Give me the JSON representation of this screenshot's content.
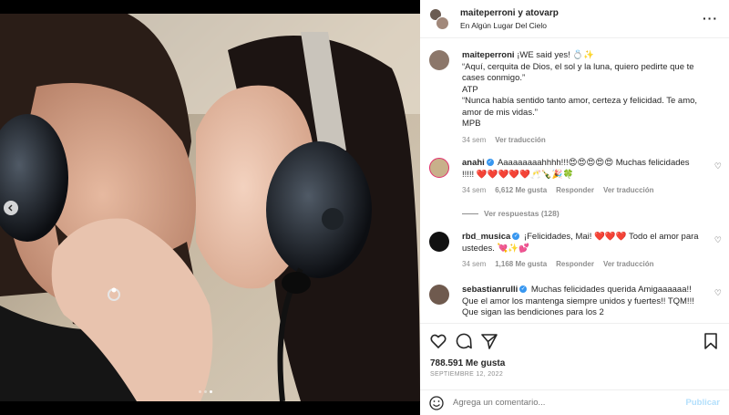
{
  "post": {
    "media": {
      "carousel_dots": 3,
      "active_dot": 2,
      "prev_icon": "chevron-left-icon"
    },
    "header": {
      "users": "maiteperroni y atovarp",
      "location": "En Algún Lugar Del Cielo",
      "more_icon": "more-horizontal-icon"
    },
    "caption": {
      "user": "maiteperroni",
      "lines": [
        "¡WE said yes! 💍✨",
        "“Aquí, cerquita de Dios, el sol y la luna, quiero pedirte que te cases conmigo.”",
        "ATP",
        "“Nunca había sentido tanto amor, certeza y felicidad. Te amo, amor de mis vidas.”",
        "MPB"
      ],
      "time": "34 sem",
      "translate": "Ver traducción"
    },
    "comments": [
      {
        "user": "anahi",
        "text": "Aaaaaaaaahhhh!!!😍😍😍😍😍 Muchas felicidades !!!!! ❤️❤️❤️❤️❤️🥂🍾🎉🍀",
        "time": "34 sem",
        "likes": "6,612 Me gusta",
        "reply": "Responder",
        "translate": "Ver traducción",
        "replies": "Ver respuestas (128)"
      },
      {
        "user": "rbd_musica",
        "text": "¡Felicidades, Mai! ❤️❤️❤️ Todo el amor para ustedes. 💘✨💕",
        "time": "34 sem",
        "likes": "1,168 Me gusta",
        "reply": "Responder",
        "translate": "Ver traducción"
      },
      {
        "user": "sebastianrulli",
        "text": "Muchas felicidades querida Amigaaaaaa!! Que el amor los mantenga siempre unidos y fuertes!! TQM!!! Que sigan las bendiciones para los 2"
      }
    ],
    "actions": {
      "like_icon": "heart-icon",
      "comment_icon": "comment-icon",
      "share_icon": "send-icon",
      "save_icon": "bookmark-icon"
    },
    "likes": "788.591 Me gusta",
    "date": "SEPTIEMBRE 12, 2022",
    "add_comment": {
      "emoji_icon": "emoji-icon",
      "placeholder": "Agrega un comentario...",
      "publish": "Publicar"
    },
    "colors": {
      "verified": "#3897f0",
      "heart": "#ed4956",
      "publish": "#b2dffc",
      "meta": "#8e8e8e"
    }
  }
}
